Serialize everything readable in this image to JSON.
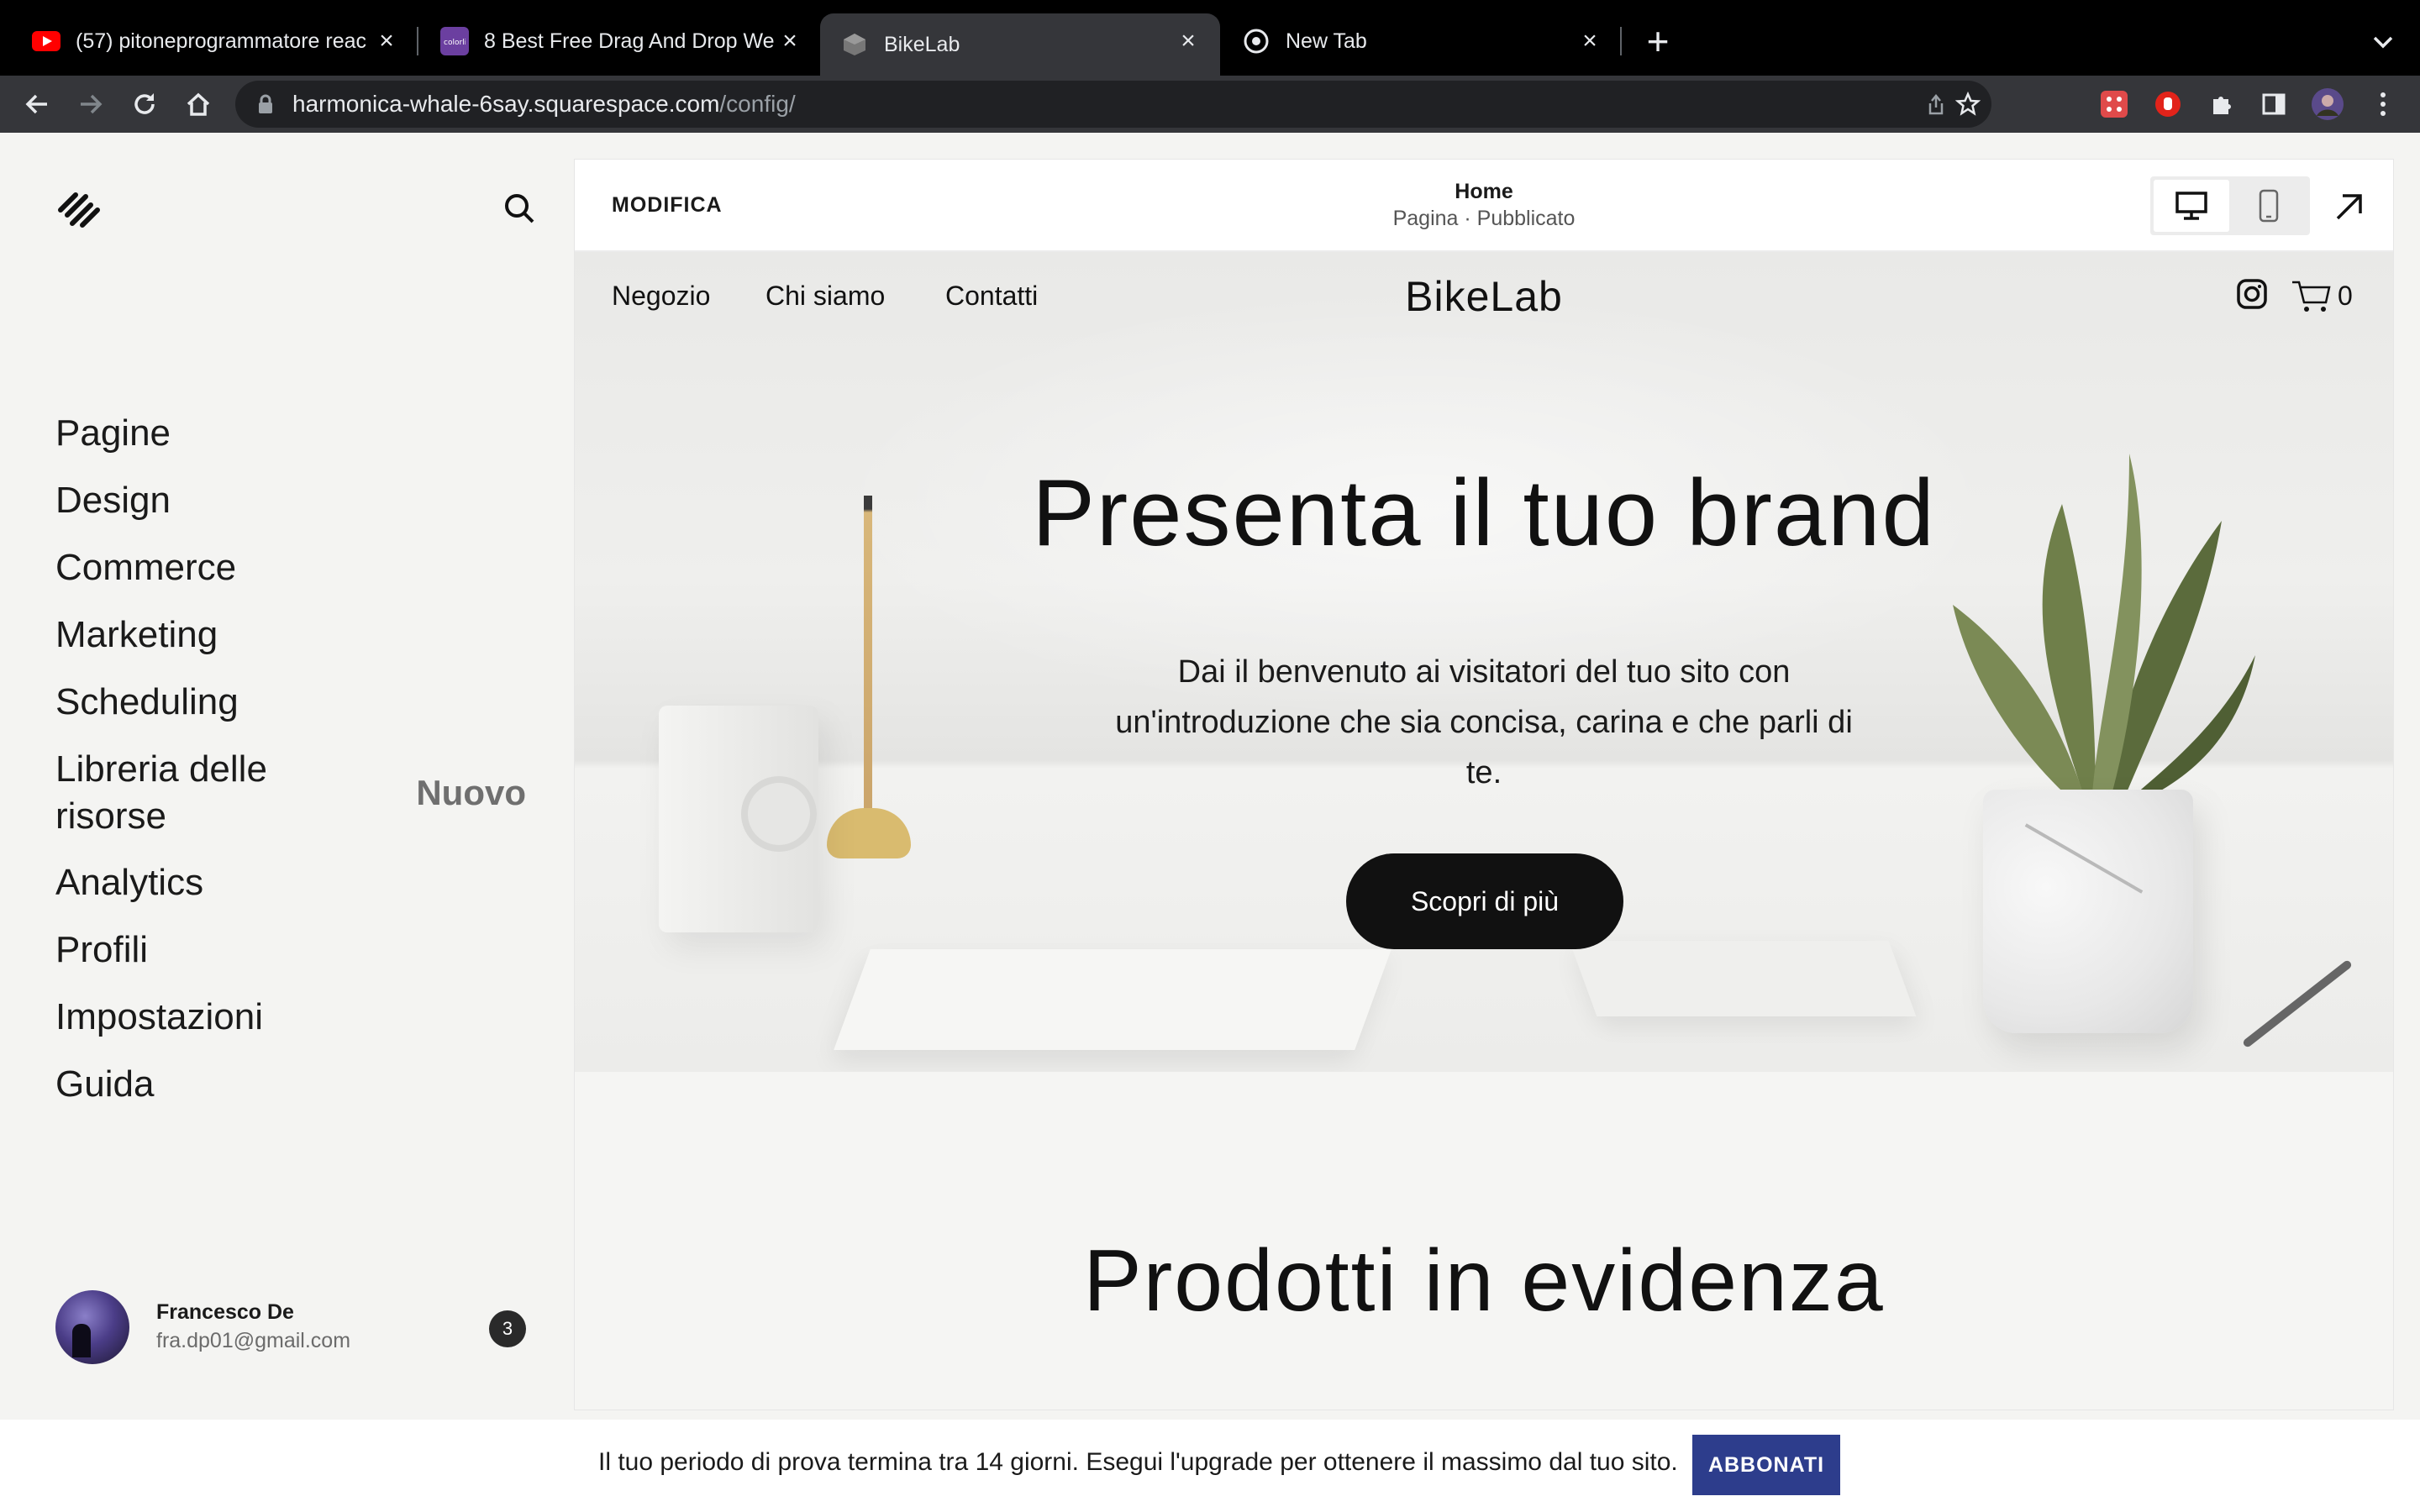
{
  "browser": {
    "tabs": [
      {
        "title": "(57) pitoneprogrammatore reac",
        "icon": "youtube-icon"
      },
      {
        "title": "8 Best Free Drag And Drop We",
        "icon": "colorlib-icon"
      },
      {
        "title": "BikeLab",
        "icon": "squarespace-cube-icon",
        "active": true
      },
      {
        "title": "New Tab",
        "icon": "chrome-icon"
      }
    ],
    "url_host": "harmonica-whale-6say.squarespace.com",
    "url_path": "/config/",
    "colors": {
      "tabbar": "#000000",
      "toolbar": "#35363a",
      "omnibox": "#202124"
    }
  },
  "sidebar": {
    "menu": [
      {
        "label": "Pagine"
      },
      {
        "label": "Design"
      },
      {
        "label": "Commerce"
      },
      {
        "label": "Marketing"
      },
      {
        "label": "Scheduling"
      },
      {
        "label": "Libreria delle risorse",
        "badge": "Nuovo"
      },
      {
        "label": "Analytics"
      },
      {
        "label": "Profili"
      },
      {
        "label": "Impostazioni"
      },
      {
        "label": "Guida"
      }
    ],
    "user": {
      "name": "Francesco De",
      "email": "fra.dp01@gmail.com",
      "notifications": "3"
    }
  },
  "editor": {
    "edit_label": "MODIFICA",
    "page_title": "Home",
    "page_status": "Pagina · Pubblicato"
  },
  "site": {
    "nav": [
      "Negozio",
      "Chi siamo",
      "Contatti"
    ],
    "logo": "BikeLab",
    "cart_count": "0",
    "hero_title": "Presenta il tuo brand",
    "hero_body": "Dai il benvenuto ai visitatori del tuo sito con un'introduzione che sia concisa, carina e che parli di te.",
    "hero_cta": "Scopri di più",
    "section_title": "Prodotti in evidenza"
  },
  "trial": {
    "text": "Il tuo periodo di prova termina tra 14 giorni. Esegui l'upgrade per ottenere il massimo dal tuo sito.",
    "button": "ABBONATI",
    "button_color": "#2d3d8c"
  }
}
